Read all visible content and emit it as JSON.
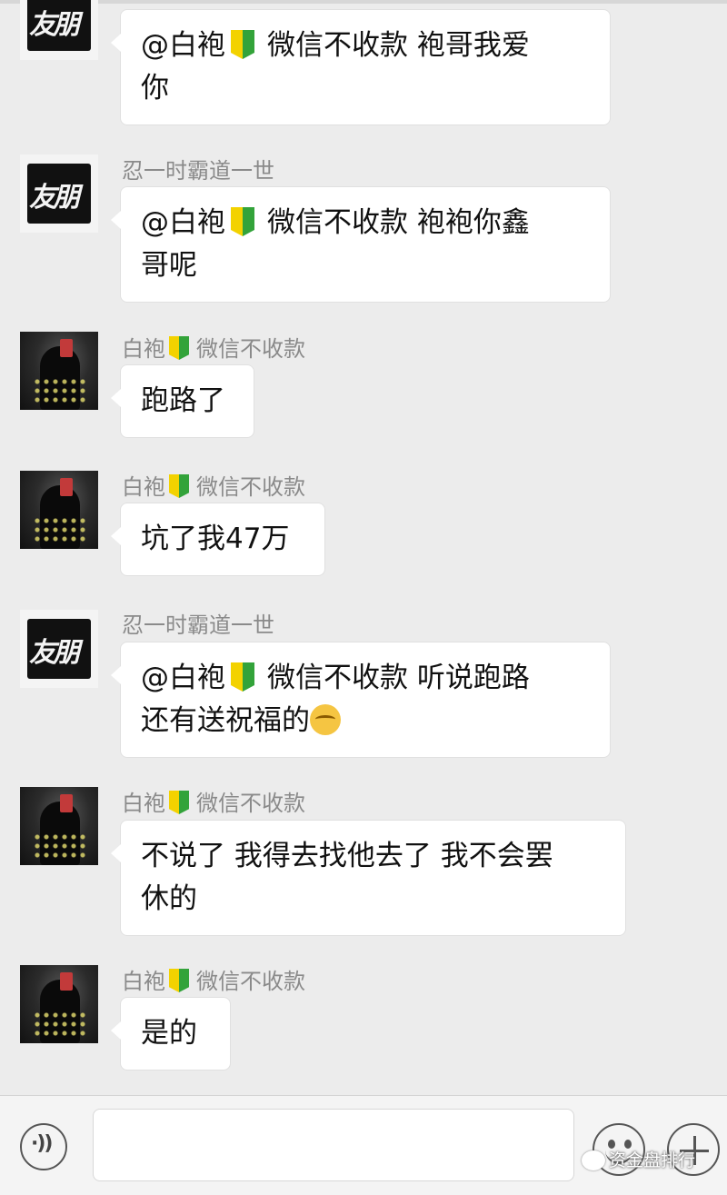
{
  "messages": [
    {
      "avatar": "friend-seal",
      "sender": {
        "name": "",
        "has_badge": false,
        "suffix": ""
      },
      "lines": [
        "@白袍 ",
        " 微信不收款 袍哥我爱",
        "你"
      ],
      "mention": {
        "name": "@白袍",
        "tail": "微信不收款 袍哥我爱"
      }
    },
    {
      "avatar": "friend-seal",
      "sender": {
        "name": "忍一时霸道一世"
      },
      "mention": {
        "name": "@白袍",
        "tail": "微信不收款 袍袍你鑫"
      },
      "line2": "哥呢"
    },
    {
      "avatar": "hooded-figure",
      "sender": {
        "name": "白袍",
        "suffix": "微信不收款"
      },
      "text": "跑路了"
    },
    {
      "avatar": "hooded-figure",
      "sender": {
        "name": "白袍",
        "suffix": "微信不收款"
      },
      "text": "坑了我47万"
    },
    {
      "avatar": "friend-seal",
      "sender": {
        "name": "忍一时霸道一世"
      },
      "mention": {
        "name": "@白袍",
        "tail": "微信不收款 听说跑路"
      },
      "line2": "还有送祝福的"
    },
    {
      "avatar": "hooded-figure",
      "sender": {
        "name": "白袍",
        "suffix": "微信不收款"
      },
      "line1": "不说了 我得去找他去了 我不会罢",
      "line2": "休的"
    },
    {
      "avatar": "hooded-figure",
      "sender": {
        "name": "白袍",
        "suffix": "微信不收款"
      },
      "text": "是的"
    }
  ],
  "input": {
    "value": ""
  },
  "icons": {
    "voice": "voice-icon",
    "emoji": "emoji-icon",
    "plus": "plus-icon",
    "badge": "beginner-badge-icon",
    "thinking": "thinking-face-icon"
  },
  "colors": {
    "background": "#ececec",
    "bubble": "#ffffff",
    "sender": "#8a8a8a",
    "badge_yellow": "#f3d200",
    "badge_green": "#33a33a"
  },
  "watermark": {
    "text": "资金盘排行"
  }
}
